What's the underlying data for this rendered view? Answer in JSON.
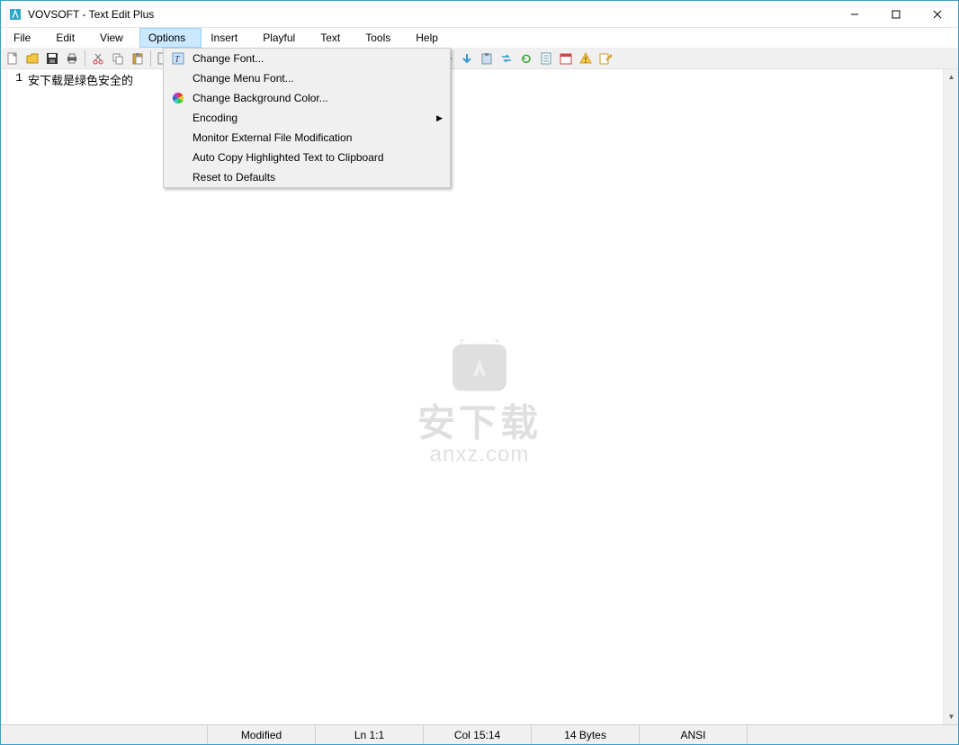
{
  "window": {
    "title": "VOVSOFT - Text Edit Plus"
  },
  "menubar": {
    "items": [
      {
        "label": "File"
      },
      {
        "label": "Edit"
      },
      {
        "label": "View"
      },
      {
        "label": "Options"
      },
      {
        "label": "Insert"
      },
      {
        "label": "Playful"
      },
      {
        "label": "Text"
      },
      {
        "label": "Tools"
      },
      {
        "label": "Help"
      }
    ],
    "active_index": 3
  },
  "dropdown": {
    "items": [
      {
        "label": "Change Font...",
        "icon": "font-icon",
        "has_submenu": false
      },
      {
        "label": "Change Menu Font...",
        "icon": "",
        "has_submenu": false
      },
      {
        "label": "Change Background Color...",
        "icon": "color-wheel-icon",
        "has_submenu": false
      },
      {
        "label": "Encoding",
        "icon": "",
        "has_submenu": true
      },
      {
        "label": "Monitor External File Modification",
        "icon": "",
        "has_submenu": false
      },
      {
        "label": "Auto Copy Highlighted Text to Clipboard",
        "icon": "",
        "has_submenu": false
      },
      {
        "label": "Reset to Defaults",
        "icon": "",
        "has_submenu": false
      }
    ]
  },
  "editor": {
    "line_number": "1",
    "text": "安下载是绿色安全的"
  },
  "statusbar": {
    "modified": "Modified",
    "line": "Ln 1:1",
    "col": "Col 15:14",
    "bytes": "14 Bytes",
    "encoding": "ANSI"
  },
  "watermark": {
    "cn": "安下载",
    "en": "anxz.com"
  }
}
